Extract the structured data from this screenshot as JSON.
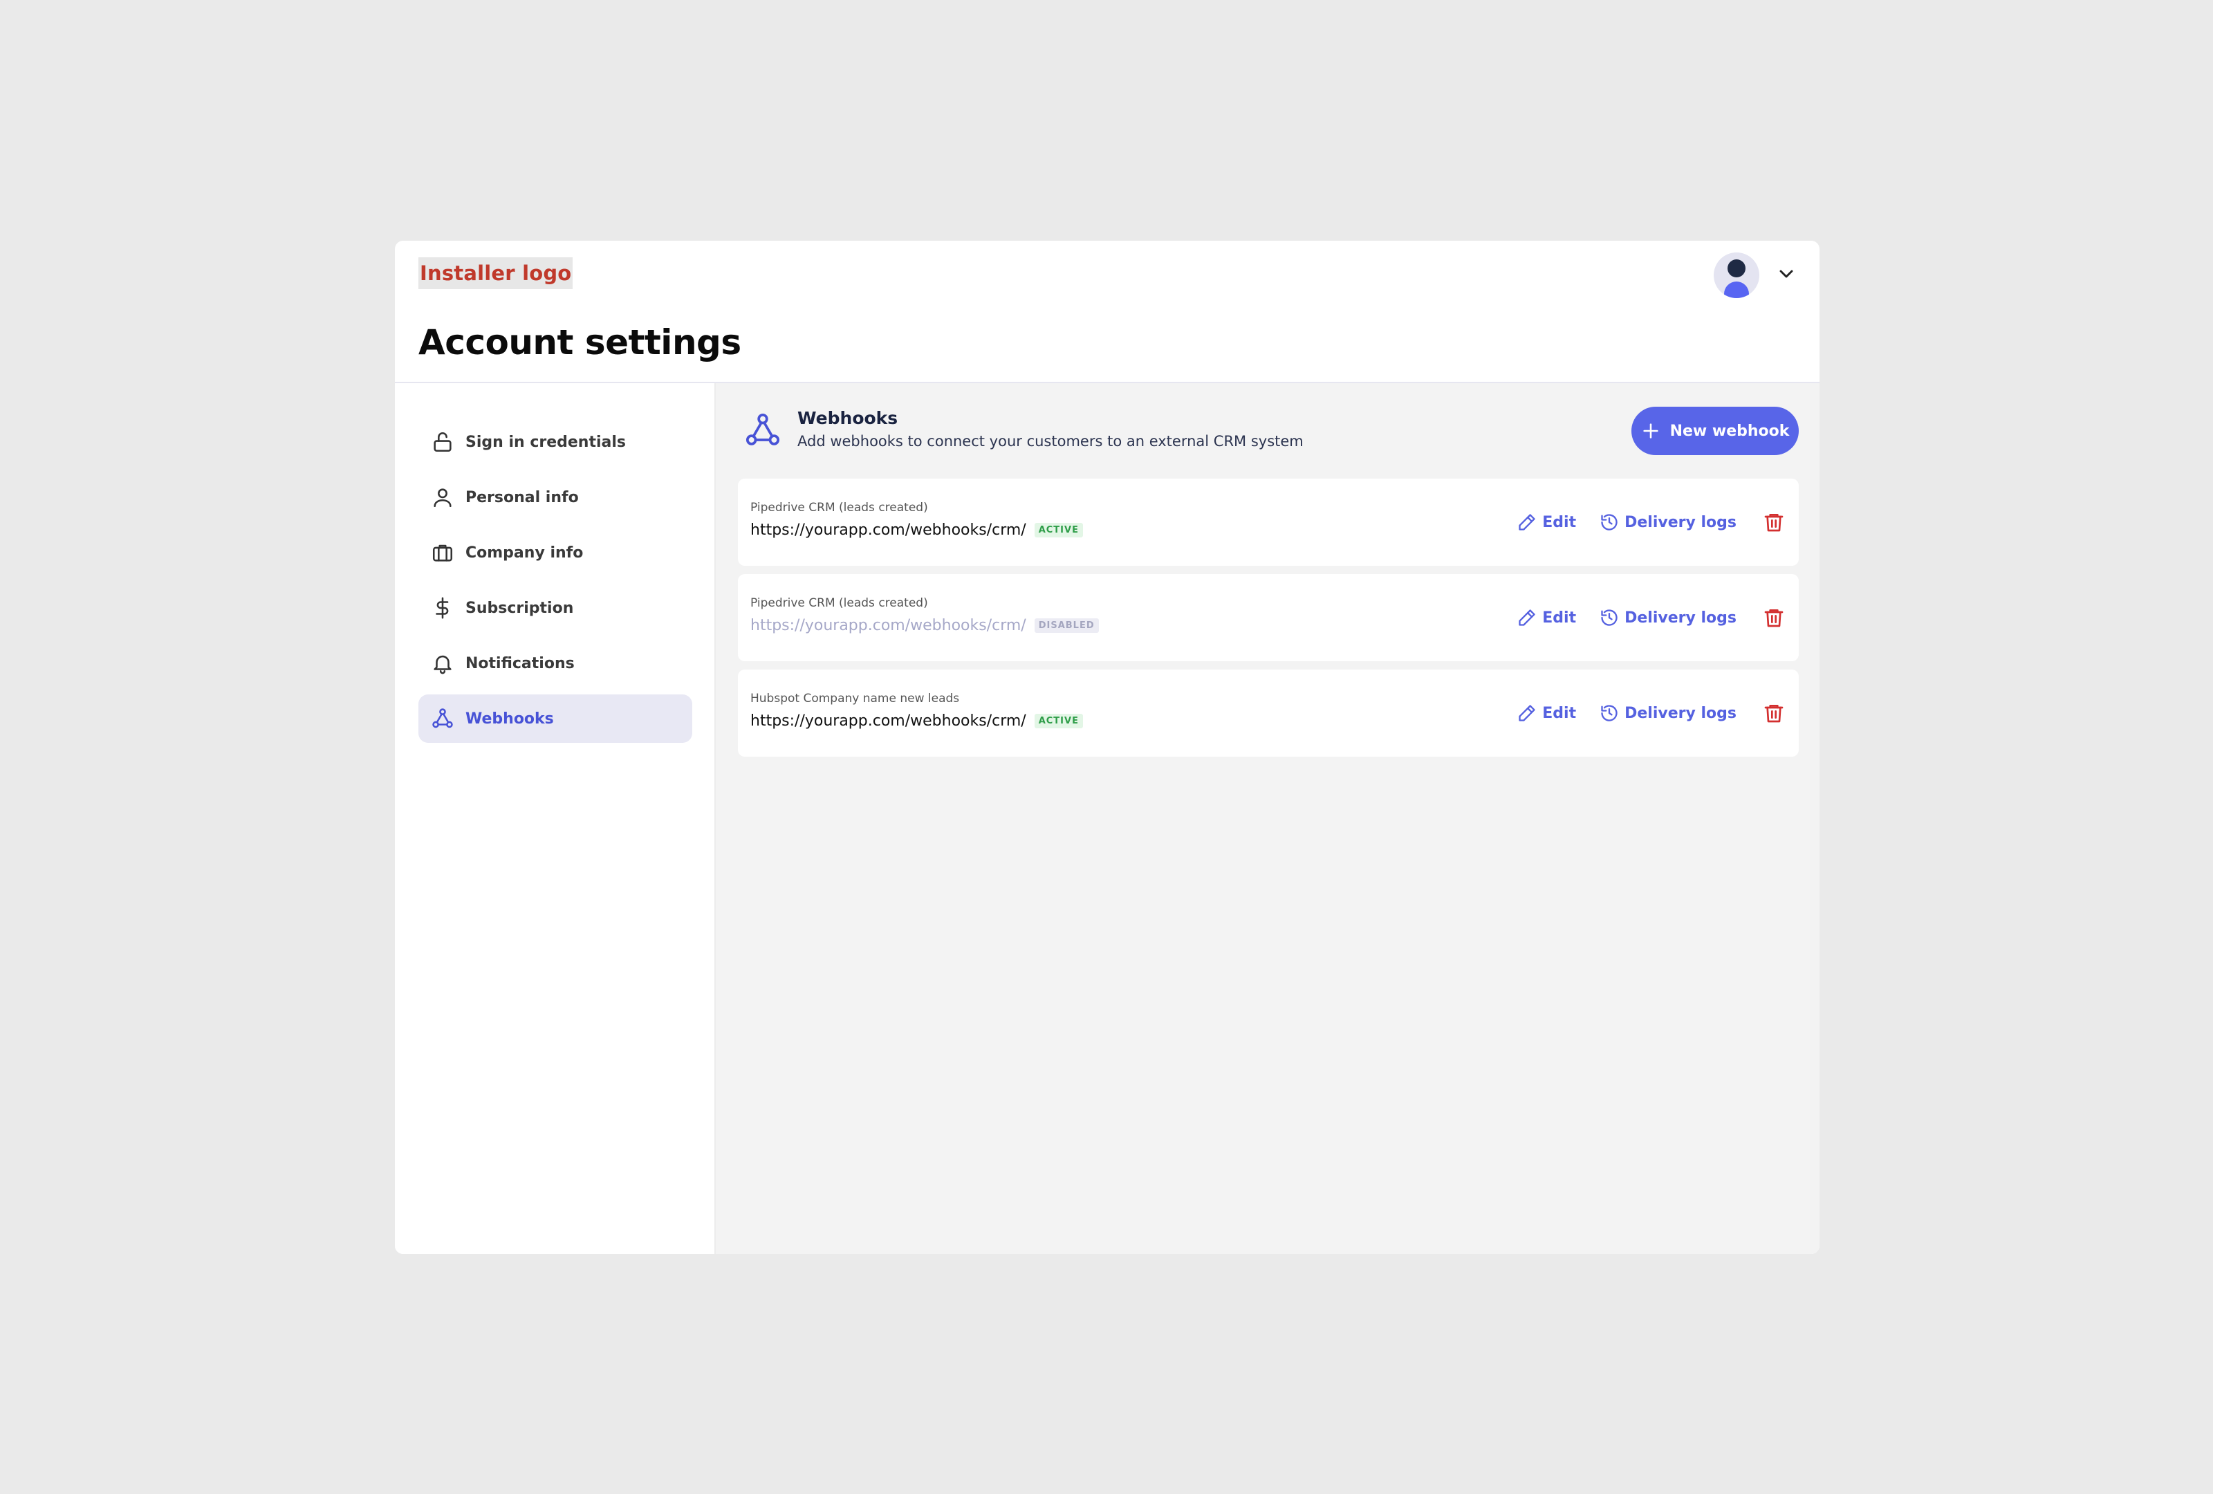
{
  "header": {
    "logo_text": "Installer logo",
    "page_title": "Account settings"
  },
  "sidebar": {
    "items": [
      {
        "label": "Sign in credentials",
        "icon": "lock-icon"
      },
      {
        "label": "Personal info",
        "icon": "user-icon"
      },
      {
        "label": "Company info",
        "icon": "briefcase-icon"
      },
      {
        "label": "Subscription",
        "icon": "dollar-icon"
      },
      {
        "label": "Notifications",
        "icon": "bell-icon"
      },
      {
        "label": "Webhooks",
        "icon": "webhook-icon",
        "active": true
      }
    ]
  },
  "main": {
    "title": "Webhooks",
    "subtitle": "Add webhooks to connect your customers to an external CRM system",
    "new_button": "New webhook",
    "webhooks": [
      {
        "name": "Pipedrive CRM (leads created)",
        "url": "https://yourapp.com/webhooks/crm/",
        "status": "ACTIVE"
      },
      {
        "name": "Pipedrive CRM (leads created)",
        "url": "https://yourapp.com/webhooks/crm/",
        "status": "DISABLED"
      },
      {
        "name": "Hubspot Company name new leads",
        "url": "https://yourapp.com/webhooks/crm/",
        "status": "ACTIVE"
      }
    ],
    "edit_label": "Edit",
    "logs_label": "Delivery logs"
  },
  "colors": {
    "accent": "#5865e8",
    "active_nav_text": "#4752d6",
    "active_nav_bg": "#e8e8f4",
    "danger": "#d32f2f",
    "active_badge": "#2e9d48",
    "logo_text": "#c0392b"
  }
}
